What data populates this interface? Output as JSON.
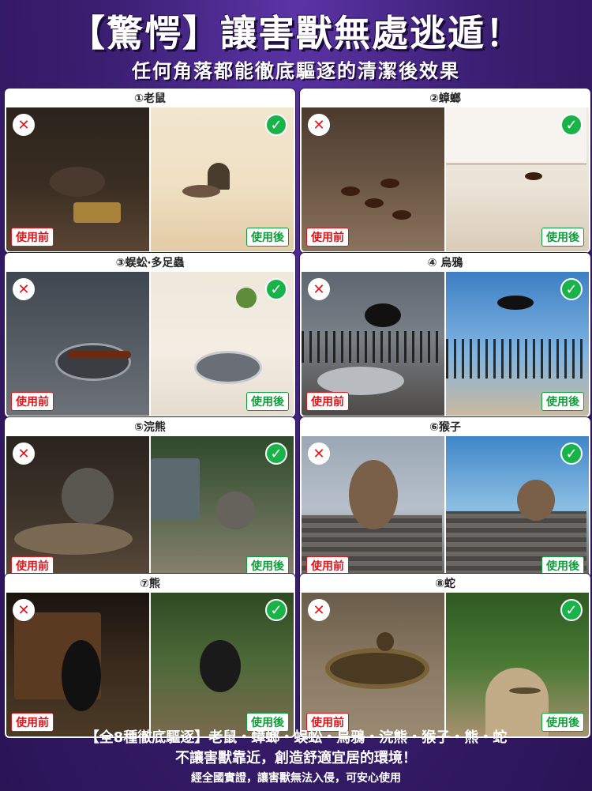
{
  "header": {
    "title": "【驚愕】讓害獸無處逃遁！",
    "subtitle": "任何角落都能徹底驅逐的清潔後效果"
  },
  "labels": {
    "before": "使用前",
    "after": "使用後",
    "x_mark": "✕",
    "ok_mark": "✓"
  },
  "panels": [
    {
      "title": "①老鼠"
    },
    {
      "title": "②蟑螂"
    },
    {
      "title": "③蜈蚣‧多足蟲"
    },
    {
      "title": "④ 烏鴉"
    },
    {
      "title": "⑤浣熊"
    },
    {
      "title": "⑥猴子"
    },
    {
      "title": "⑦熊"
    },
    {
      "title": "⑧蛇"
    }
  ],
  "footer": {
    "line1": "【全8種徹底驅逐】老鼠・蟑螂・蜈蚣・烏鴉・浣熊・猴子・熊・蛇",
    "line2": "不讓害獸靠近，創造舒適宜居的環境！",
    "line3": "經全國實證，讓害獸無法入侵，可安心使用"
  },
  "colors": {
    "background": "#3b1f72",
    "before_red": "#e0161b",
    "after_green": "#19b34a"
  }
}
